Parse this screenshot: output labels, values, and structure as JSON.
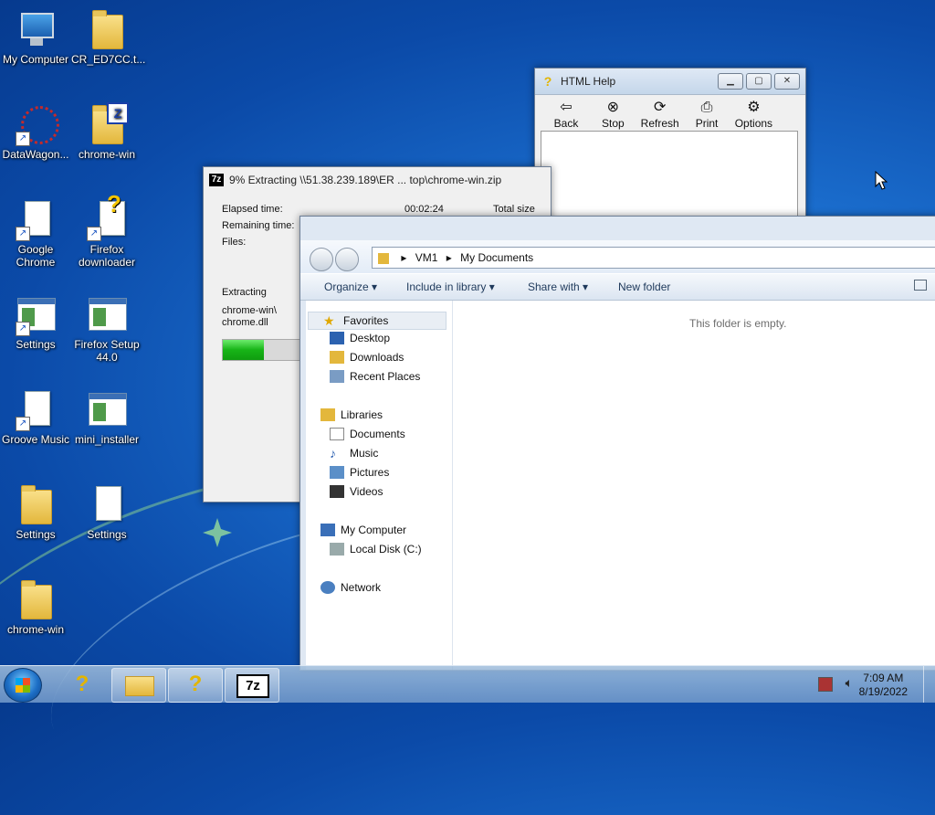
{
  "desktop": {
    "icons": [
      {
        "label": "My Computer"
      },
      {
        "label": "CR_ED7CC.t..."
      },
      {
        "label": "DataWagon..."
      },
      {
        "label": "chrome-win"
      },
      {
        "label": "Google Chrome"
      },
      {
        "label": "Firefox downloader"
      },
      {
        "label": "Settings"
      },
      {
        "label": "Firefox Setup 44.0"
      },
      {
        "label": "Groove Music"
      },
      {
        "label": "mini_installer"
      },
      {
        "label": "Settings"
      },
      {
        "label": "Settings"
      },
      {
        "label": "chrome-win"
      }
    ]
  },
  "zip": {
    "title": "9% Extracting \\\\51.38.239.189\\ER ... top\\chrome-win.zip",
    "icon_text": "7z",
    "elapsed_label": "Elapsed time:",
    "elapsed_value": "00:02:24",
    "total_label": "Total size",
    "remaining_label": "Remaining time:",
    "files_label": "Files:",
    "status": "Extracting",
    "path_line1": "chrome-win\\",
    "path_line2": "chrome.dll",
    "progress": 0.09
  },
  "help": {
    "title": "HTML Help",
    "toolbar": [
      "Back",
      "Stop",
      "Refresh",
      "Print",
      "Options"
    ]
  },
  "explorer": {
    "breadcrumb": [
      "VM1",
      "My Documents"
    ],
    "commands": [
      "Organize",
      "Include in library",
      "Share with",
      "New folder"
    ],
    "nav": {
      "favorites": "Favorites",
      "desktop": "Desktop",
      "downloads": "Downloads",
      "recent": "Recent Places",
      "libraries": "Libraries",
      "documents": "Documents",
      "music": "Music",
      "pictures": "Pictures",
      "videos": "Videos",
      "computer": "My Computer",
      "disk": "Local Disk (C:)",
      "network": "Network"
    },
    "empty_message": "This folder is empty."
  },
  "taskbar": {
    "zip_label": "7z",
    "time": "7:09 AM",
    "date": "8/19/2022"
  }
}
